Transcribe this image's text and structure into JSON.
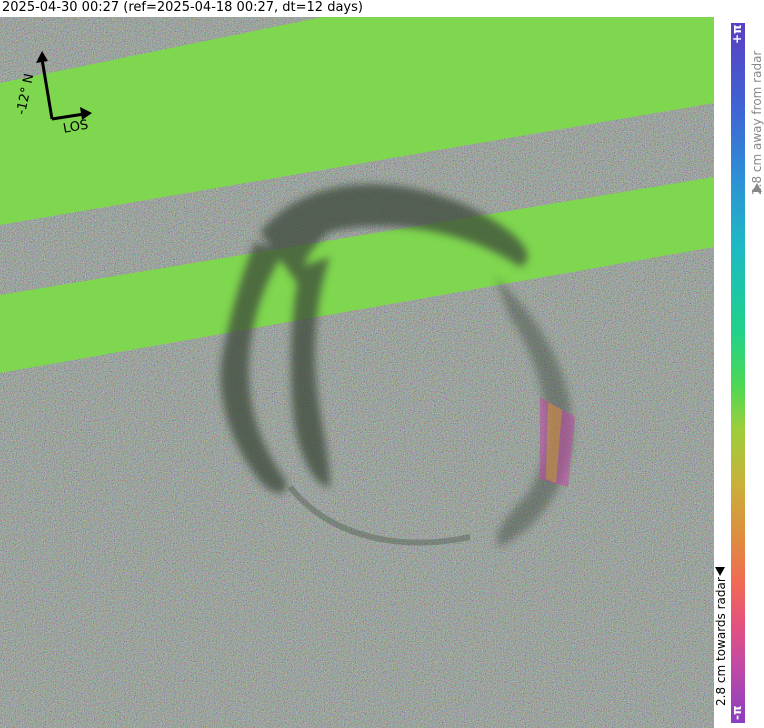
{
  "title": "2025-04-30 00:27 (ref=2025-04-18 00:27, dt=12 days)",
  "compass": {
    "north_label": "-12° N",
    "los_label": "LOS"
  },
  "colorbar": {
    "top_label": "+π",
    "bottom_label": "-π",
    "away_label": "2.8 cm away from radar",
    "towards_label": "2.8 cm towards radar"
  },
  "colors": {
    "noise_background": "#6f7f74",
    "coherent_band": "#7fd64f",
    "crater_shadow": "#3d4a3a"
  }
}
